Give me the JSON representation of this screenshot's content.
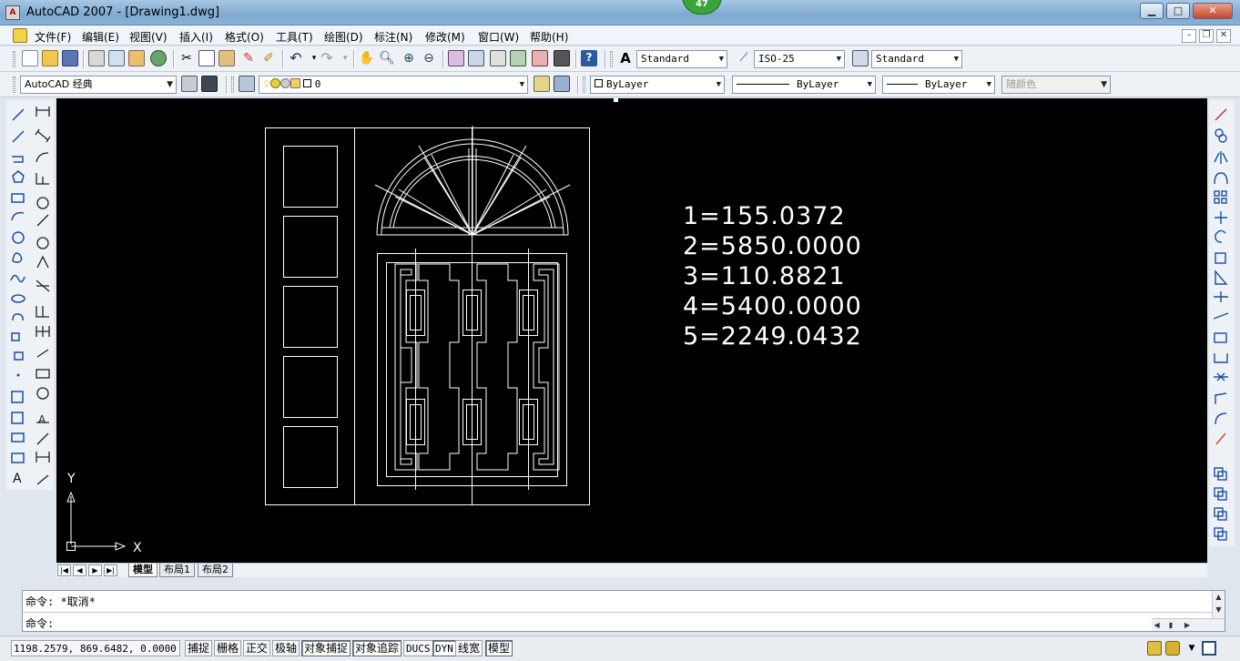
{
  "window": {
    "title": "AutoCAD 2007 - [Drawing1.dwg]",
    "badge": "47",
    "controls": {
      "minimize": "▁",
      "maximize": "□",
      "close": "✕"
    }
  },
  "menu": {
    "items": [
      "文件(F)",
      "编辑(E)",
      "视图(V)",
      "插入(I)",
      "格式(O)",
      "工具(T)",
      "绘图(D)",
      "标注(N)",
      "修改(M)",
      "窗口(W)",
      "帮助(H)"
    ],
    "mdi_controls": {
      "minimize": "–",
      "restore": "❐",
      "close": "✕"
    }
  },
  "toolbar1": {
    "text_style": "Standard",
    "dim_style": "ISO-25",
    "table_style": "Standard"
  },
  "toolbar2": {
    "workspace": "AutoCAD 经典",
    "layer": "0",
    "color": "ByLayer",
    "linetype": "ByLayer",
    "lineweight": "ByLayer",
    "plot_style": "随颜色"
  },
  "canvas": {
    "measurements": [
      "1=155.0372",
      "2=5850.0000",
      "3=110.8821",
      "4=5400.0000",
      "5=2249.0432"
    ],
    "ucs": {
      "y_label": "Y",
      "x_label": "X"
    }
  },
  "layout_tabs": {
    "nav": [
      "|◀",
      "◀",
      "▶",
      "▶|"
    ],
    "tabs": [
      "模型",
      "布局1",
      "布局2"
    ],
    "active": "模型"
  },
  "command": {
    "history": "命令: *取消*",
    "prompt": "命令:"
  },
  "status": {
    "coordinates": "1198.2579, 869.6482, 0.0000",
    "toggles": [
      "捕捉",
      "栅格",
      "正交",
      "极轴",
      "对象捕捉",
      "对象追踪",
      "DUCS",
      "DYN",
      "线宽",
      "模型"
    ],
    "pressed": [
      "对象捕捉",
      "对象追踪",
      "DYN",
      "模型"
    ]
  },
  "colors": {
    "canvas_bg": "#000000",
    "drawing_stroke": "#ffffff",
    "titlebar": "#8ab2d8",
    "badge": "#3aa53a"
  }
}
